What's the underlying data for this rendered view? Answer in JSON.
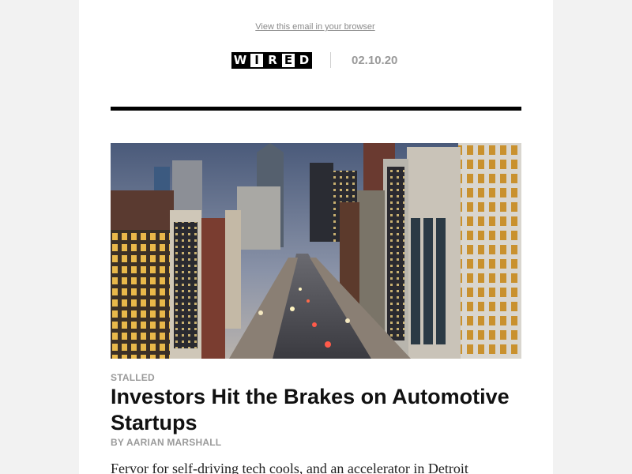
{
  "header": {
    "browser_link": "View this email in your browser",
    "logo_letters": [
      "W",
      "I",
      "R",
      "E",
      "D"
    ],
    "date": "02.10.20"
  },
  "article": {
    "kicker": "STALLED",
    "headline": "Investors Hit the Brakes on Automotive Startups",
    "byline": "BY AARIAN MARSHALL",
    "dek": "Fervor for self-driving tech cools, and an accelerator in Detroit"
  },
  "colors": {
    "page_bg": "#f2f2f2",
    "email_bg": "#ffffff",
    "rule": "#000000",
    "meta_gray": "#9a9a9a"
  }
}
